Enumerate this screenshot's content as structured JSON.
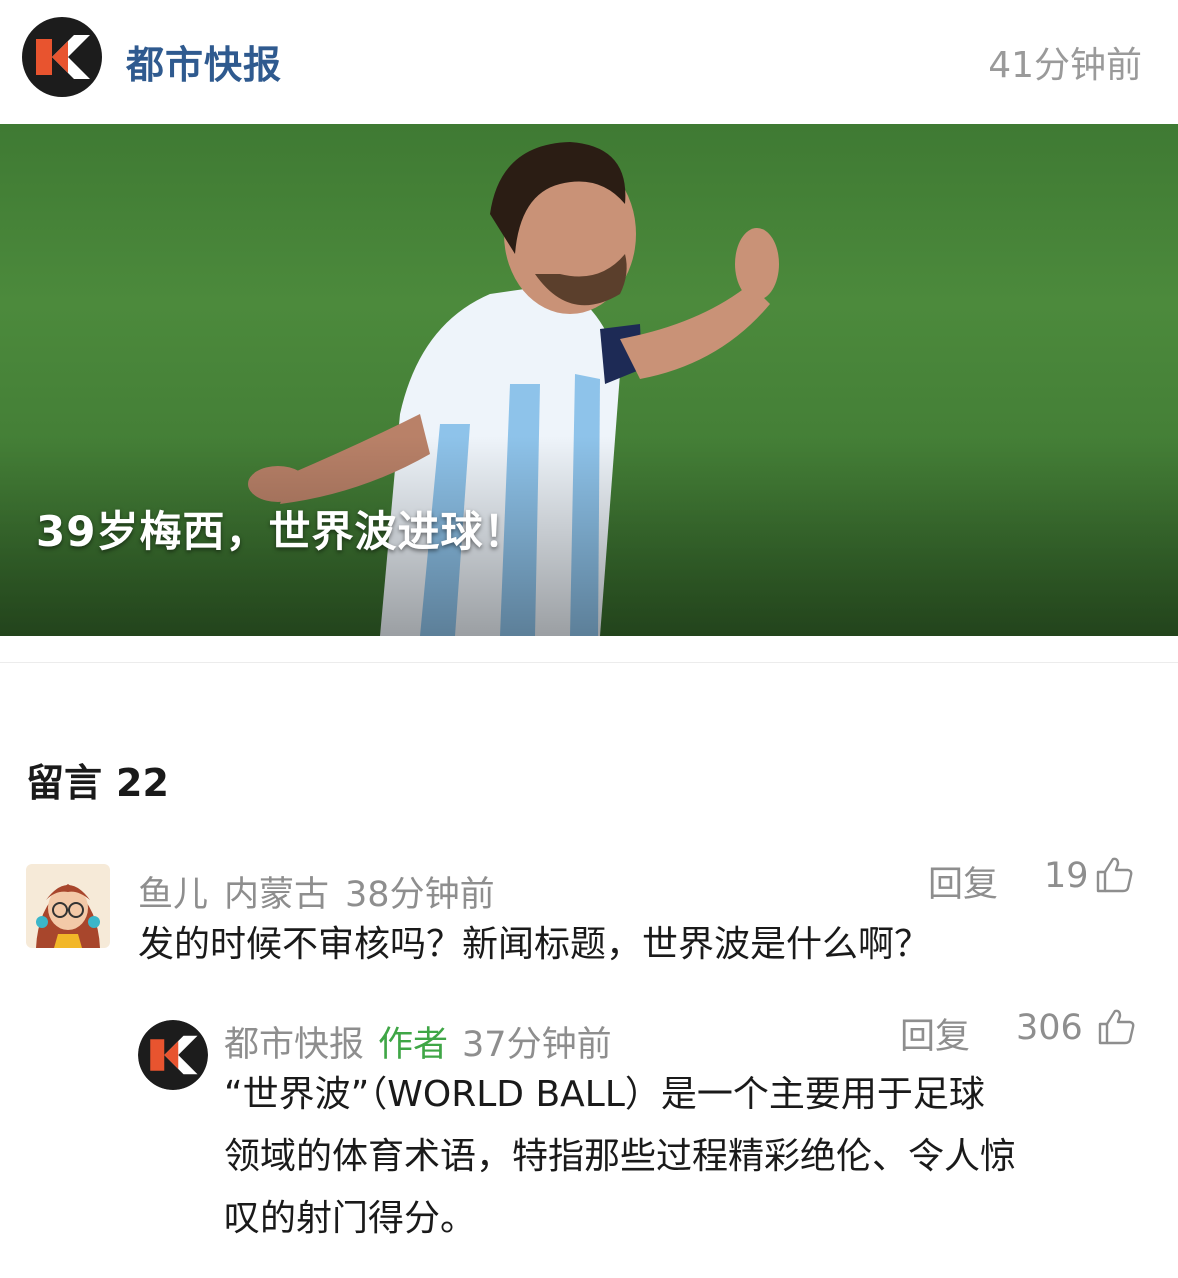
{
  "header": {
    "account_name": "都市快报",
    "post_time": "41分钟前"
  },
  "video": {
    "caption": "39岁梅西，世界波进球！"
  },
  "comments_section": {
    "label": "留言",
    "count": "22"
  },
  "comments": [
    {
      "user": "鱼儿",
      "location": "内蒙古",
      "time": "38分钟前",
      "reply_label": "回复",
      "likes": "19",
      "text": "发的时候不审核吗？新闻标题，世界波是什么啊？"
    }
  ],
  "reply": {
    "user": "都市快报",
    "author_tag": "作者",
    "time": "37分钟前",
    "reply_label": "回复",
    "likes": "306",
    "text_lines": [
      "“世界波”（WORLD BALL）是一个主要用于足球",
      "领域的体育术语，特指那些过程精彩绝伦、令人惊",
      "叹的射门得分。"
    ]
  },
  "colors": {
    "account_blue": "#2f5a8f",
    "author_green": "#3fa646",
    "logo_orange": "#e8542f",
    "meta_gray": "#8e8e8e"
  },
  "icons": [
    "logo-icon",
    "thumbs-up-icon"
  ]
}
